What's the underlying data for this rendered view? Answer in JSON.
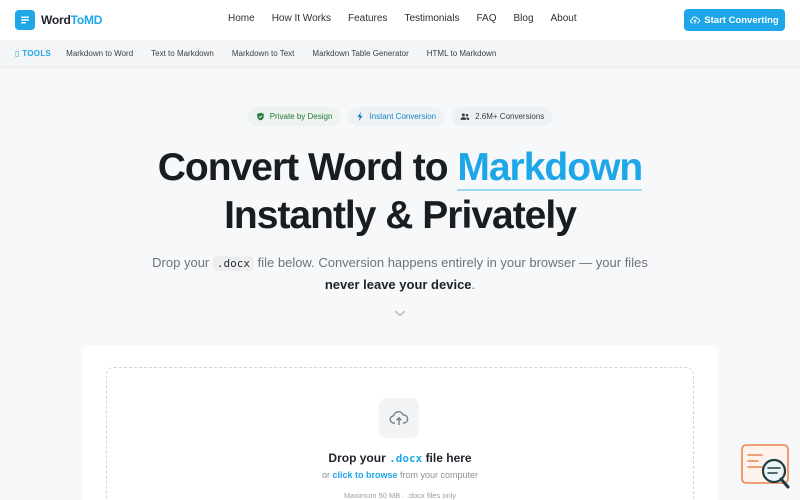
{
  "brand": {
    "name_main": "Word",
    "name_accent": "ToMD",
    "accent_color": "#1ea7e8"
  },
  "nav": {
    "items": [
      "Home",
      "How It Works",
      "Features",
      "Testimonials",
      "FAQ",
      "Blog",
      "About"
    ],
    "cta_label": "Start Converting"
  },
  "tools": {
    "label": "TOOLS",
    "items": [
      "Markdown to Word",
      "Text to Markdown",
      "Markdown to Text",
      "Markdown Table Generator",
      "HTML to Markdown"
    ]
  },
  "badges": [
    {
      "label": "Private by Design",
      "icon": "shield-check-icon"
    },
    {
      "label": "Instant Conversion",
      "icon": "lightning-icon"
    },
    {
      "label": "2.6M+ Conversions",
      "icon": "users-icon"
    }
  ],
  "hero": {
    "title_part1": "Convert Word to",
    "title_highlight": "Markdown",
    "title_line2": "Instantly & Privately",
    "subtitle_pre": "Drop your",
    "subtitle_code": ".docx",
    "subtitle_mid": "file below. Conversion happens entirely in your browser — your files",
    "subtitle_strong": "never leave your device",
    "subtitle_end": "."
  },
  "dropzone": {
    "title_pre": "Drop your",
    "title_ext": ".docx",
    "title_post": "file here",
    "sub_pre": "or",
    "sub_link": "click to browse",
    "sub_post": "from your computer",
    "max_text": "Maximum 50 MB · .docx files only"
  }
}
